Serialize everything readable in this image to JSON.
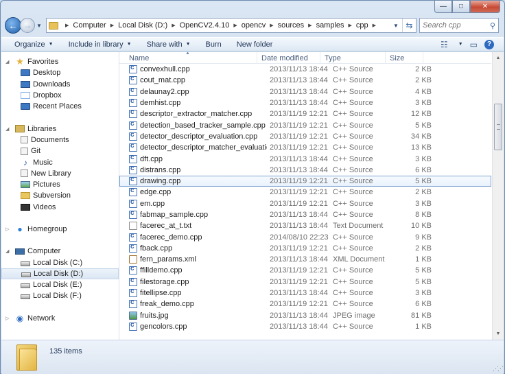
{
  "window": {
    "buttons": {
      "minimize": "—",
      "maximize": "□",
      "close": "✕"
    }
  },
  "address": {
    "crumbs": [
      "Computer",
      "Local Disk (D:)",
      "OpenCV2.4.10",
      "opencv",
      "sources",
      "samples",
      "cpp"
    ]
  },
  "search": {
    "placeholder": "Search cpp"
  },
  "toolbar": {
    "organize": "Organize",
    "include_in_library": "Include in library",
    "share_with": "Share with",
    "burn": "Burn",
    "new_folder": "New folder"
  },
  "sidebar": {
    "favorites": "Favorites",
    "desktop": "Desktop",
    "downloads": "Downloads",
    "dropbox": "Dropbox",
    "recent_places": "Recent Places",
    "libraries": "Libraries",
    "documents": "Documents",
    "git": "Git",
    "music": "Music",
    "new_library": "New Library",
    "pictures": "Pictures",
    "subversion": "Subversion",
    "videos": "Videos",
    "homegroup": "Homegroup",
    "computer": "Computer",
    "disk_c": "Local Disk (C:)",
    "disk_d": "Local Disk (D:)",
    "disk_e": "Local Disk (E:)",
    "disk_f": "Local Disk (F:)",
    "network": "Network"
  },
  "columns": {
    "name": "Name",
    "date": "Date modified",
    "type": "Type",
    "size": "Size"
  },
  "files": [
    {
      "name": "convexhull.cpp",
      "date": "2013/11/13 18:44",
      "type": "C++ Source",
      "size": "2 KB",
      "icon": "cpp"
    },
    {
      "name": "cout_mat.cpp",
      "date": "2013/11/13 18:44",
      "type": "C++ Source",
      "size": "2 KB",
      "icon": "cpp"
    },
    {
      "name": "delaunay2.cpp",
      "date": "2013/11/13 18:44",
      "type": "C++ Source",
      "size": "4 KB",
      "icon": "cpp"
    },
    {
      "name": "demhist.cpp",
      "date": "2013/11/13 18:44",
      "type": "C++ Source",
      "size": "3 KB",
      "icon": "cpp"
    },
    {
      "name": "descriptor_extractor_matcher.cpp",
      "date": "2013/11/19 12:21",
      "type": "C++ Source",
      "size": "12 KB",
      "icon": "cpp"
    },
    {
      "name": "detection_based_tracker_sample.cpp",
      "date": "2013/11/19 12:21",
      "type": "C++ Source",
      "size": "5 KB",
      "icon": "cpp"
    },
    {
      "name": "detector_descriptor_evaluation.cpp",
      "date": "2013/11/19 12:21",
      "type": "C++ Source",
      "size": "34 KB",
      "icon": "cpp"
    },
    {
      "name": "detector_descriptor_matcher_evaluation....",
      "date": "2013/11/19 12:21",
      "type": "C++ Source",
      "size": "13 KB",
      "icon": "cpp"
    },
    {
      "name": "dft.cpp",
      "date": "2013/11/13 18:44",
      "type": "C++ Source",
      "size": "3 KB",
      "icon": "cpp"
    },
    {
      "name": "distrans.cpp",
      "date": "2013/11/13 18:44",
      "type": "C++ Source",
      "size": "6 KB",
      "icon": "cpp"
    },
    {
      "name": "drawing.cpp",
      "date": "2013/11/19 12:21",
      "type": "C++ Source",
      "size": "5 KB",
      "icon": "cpp",
      "selected": true
    },
    {
      "name": "edge.cpp",
      "date": "2013/11/19 12:21",
      "type": "C++ Source",
      "size": "2 KB",
      "icon": "cpp"
    },
    {
      "name": "em.cpp",
      "date": "2013/11/19 12:21",
      "type": "C++ Source",
      "size": "3 KB",
      "icon": "cpp"
    },
    {
      "name": "fabmap_sample.cpp",
      "date": "2013/11/13 18:44",
      "type": "C++ Source",
      "size": "8 KB",
      "icon": "cpp"
    },
    {
      "name": "facerec_at_t.txt",
      "date": "2013/11/13 18:44",
      "type": "Text Document",
      "size": "10 KB",
      "icon": "txt"
    },
    {
      "name": "facerec_demo.cpp",
      "date": "2014/08/10 22:23",
      "type": "C++ Source",
      "size": "9 KB",
      "icon": "cpp"
    },
    {
      "name": "fback.cpp",
      "date": "2013/11/19 12:21",
      "type": "C++ Source",
      "size": "2 KB",
      "icon": "cpp"
    },
    {
      "name": "fern_params.xml",
      "date": "2013/11/13 18:44",
      "type": "XML Document",
      "size": "1 KB",
      "icon": "xml"
    },
    {
      "name": "ffilldemo.cpp",
      "date": "2013/11/19 12:21",
      "type": "C++ Source",
      "size": "5 KB",
      "icon": "cpp"
    },
    {
      "name": "filestorage.cpp",
      "date": "2013/11/19 12:21",
      "type": "C++ Source",
      "size": "5 KB",
      "icon": "cpp"
    },
    {
      "name": "fitellipse.cpp",
      "date": "2013/11/13 18:44",
      "type": "C++ Source",
      "size": "3 KB",
      "icon": "cpp"
    },
    {
      "name": "freak_demo.cpp",
      "date": "2013/11/19 12:21",
      "type": "C++ Source",
      "size": "6 KB",
      "icon": "cpp"
    },
    {
      "name": "fruits.jpg",
      "date": "2013/11/13 18:44",
      "type": "JPEG image",
      "size": "81 KB",
      "icon": "jpg"
    },
    {
      "name": "gencolors.cpp",
      "date": "2013/11/13 18:44",
      "type": "C++ Source",
      "size": "1 KB",
      "icon": "cpp"
    }
  ],
  "status": {
    "item_count": "135 items"
  }
}
